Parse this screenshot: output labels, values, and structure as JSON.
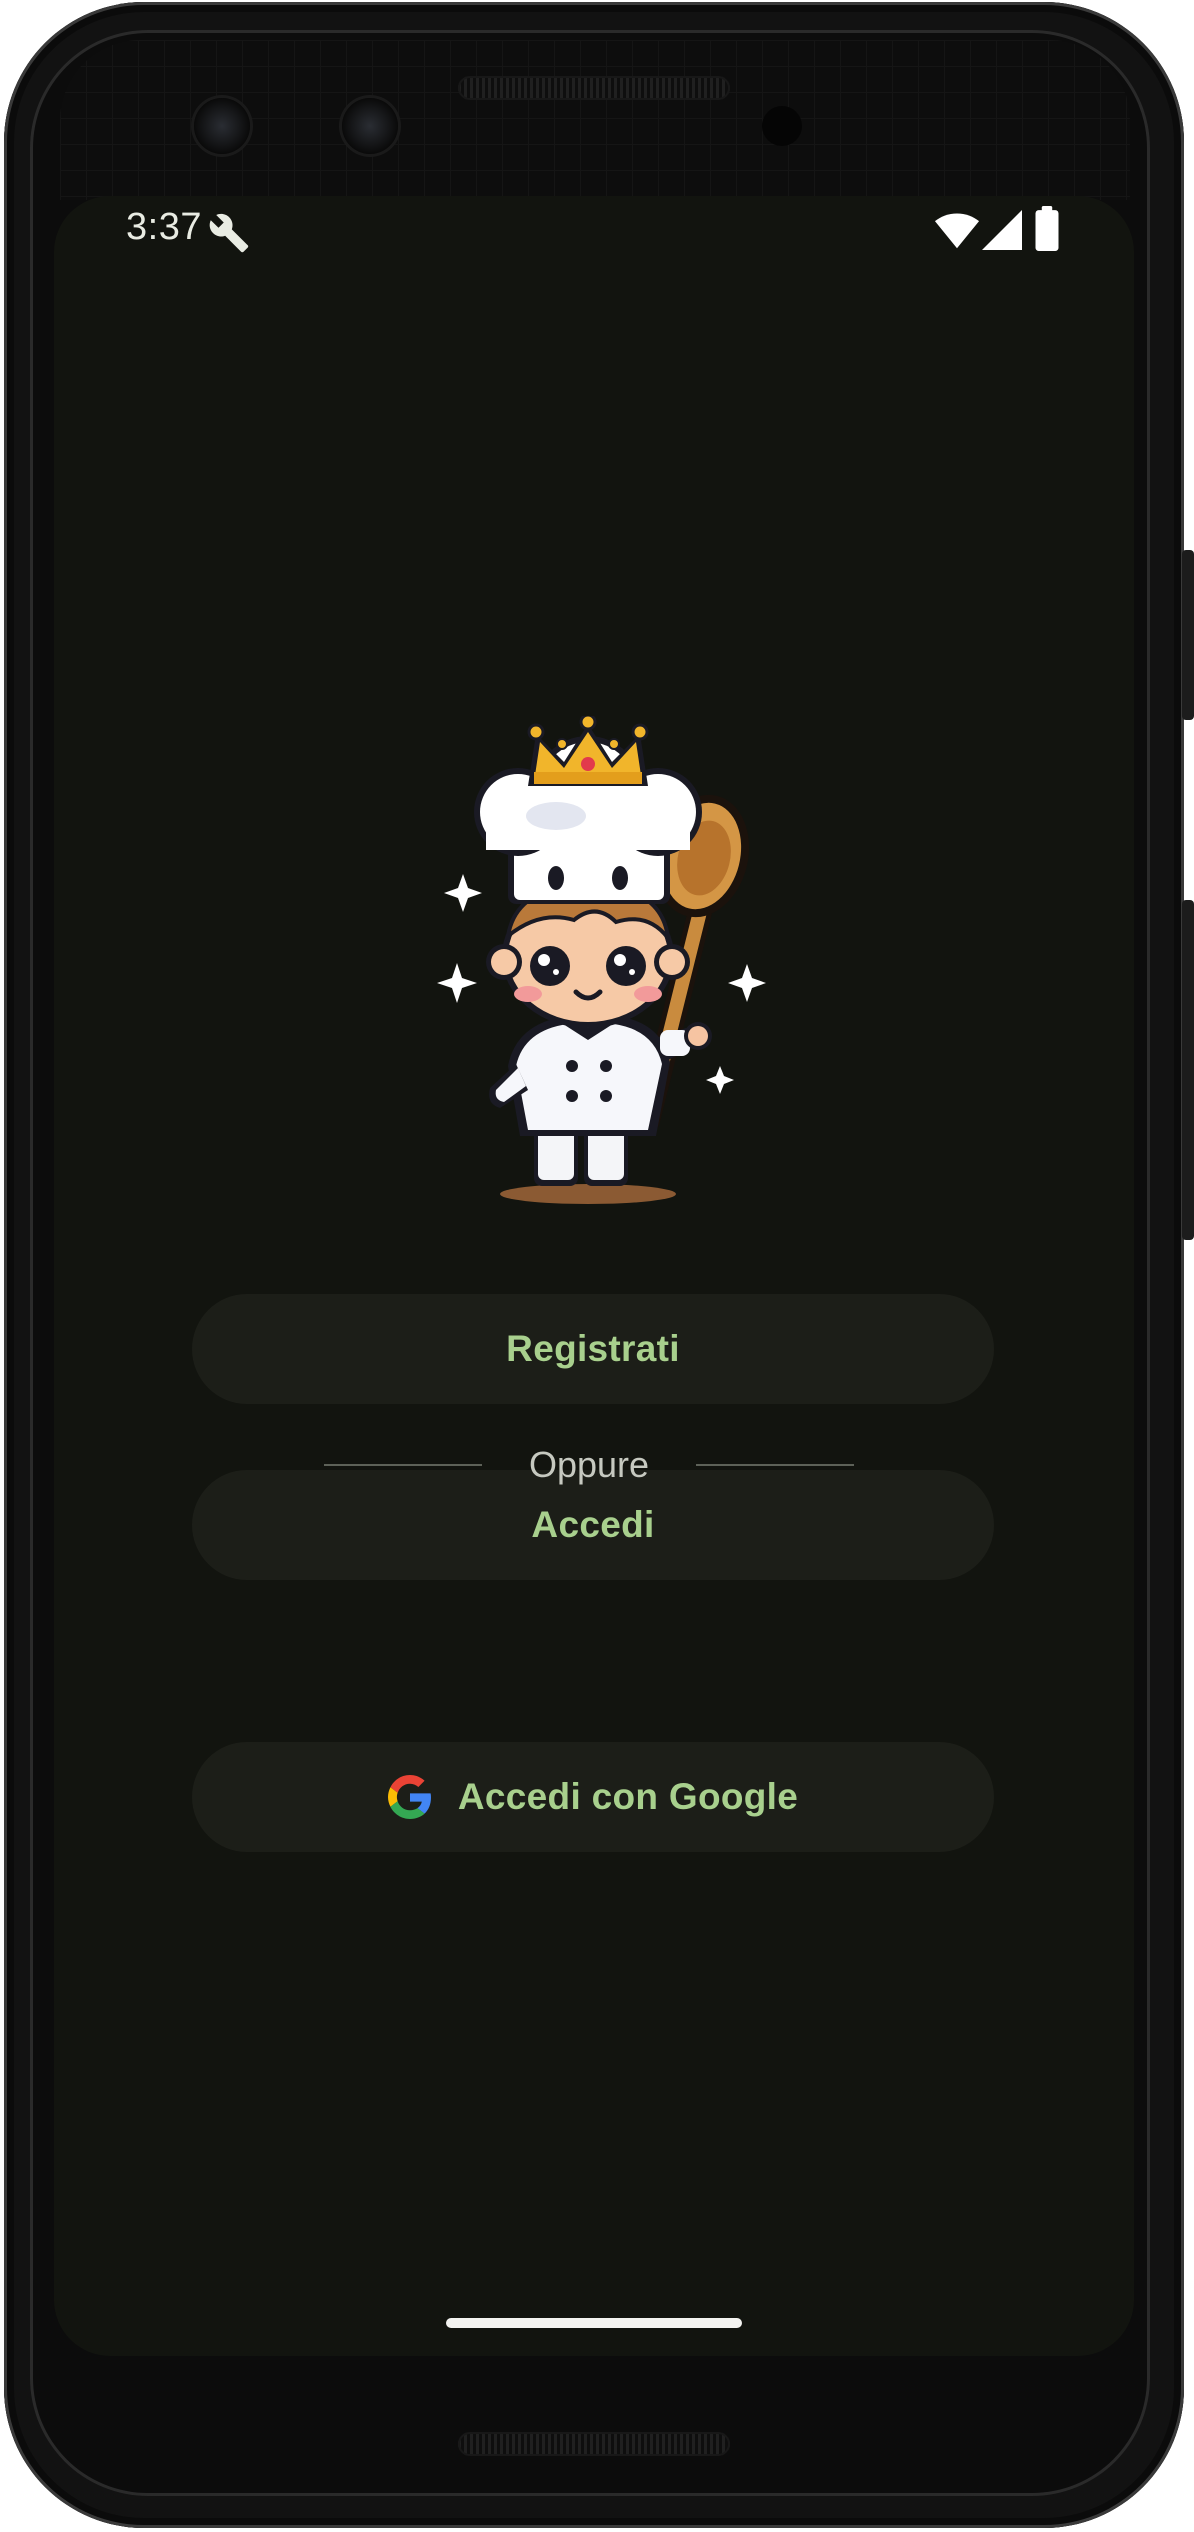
{
  "status_bar": {
    "time": "3:37",
    "icons": [
      "wrench-icon",
      "wifi-icon",
      "cell-signal-icon",
      "battery-icon"
    ]
  },
  "app": {
    "mascot_name": "chef-mascot-image",
    "buttons": {
      "register_label": "Registrati",
      "login_label": "Accedi",
      "google_label": "Accedi con Google"
    },
    "divider_text": "Oppure"
  },
  "colors": {
    "screen_background": "#12140f",
    "button_background": "#1c1e18",
    "button_text": "#a8d08d",
    "divider_line": "#5d6158",
    "divider_text": "#c6c9c0",
    "status_text": "#e9ece3"
  }
}
